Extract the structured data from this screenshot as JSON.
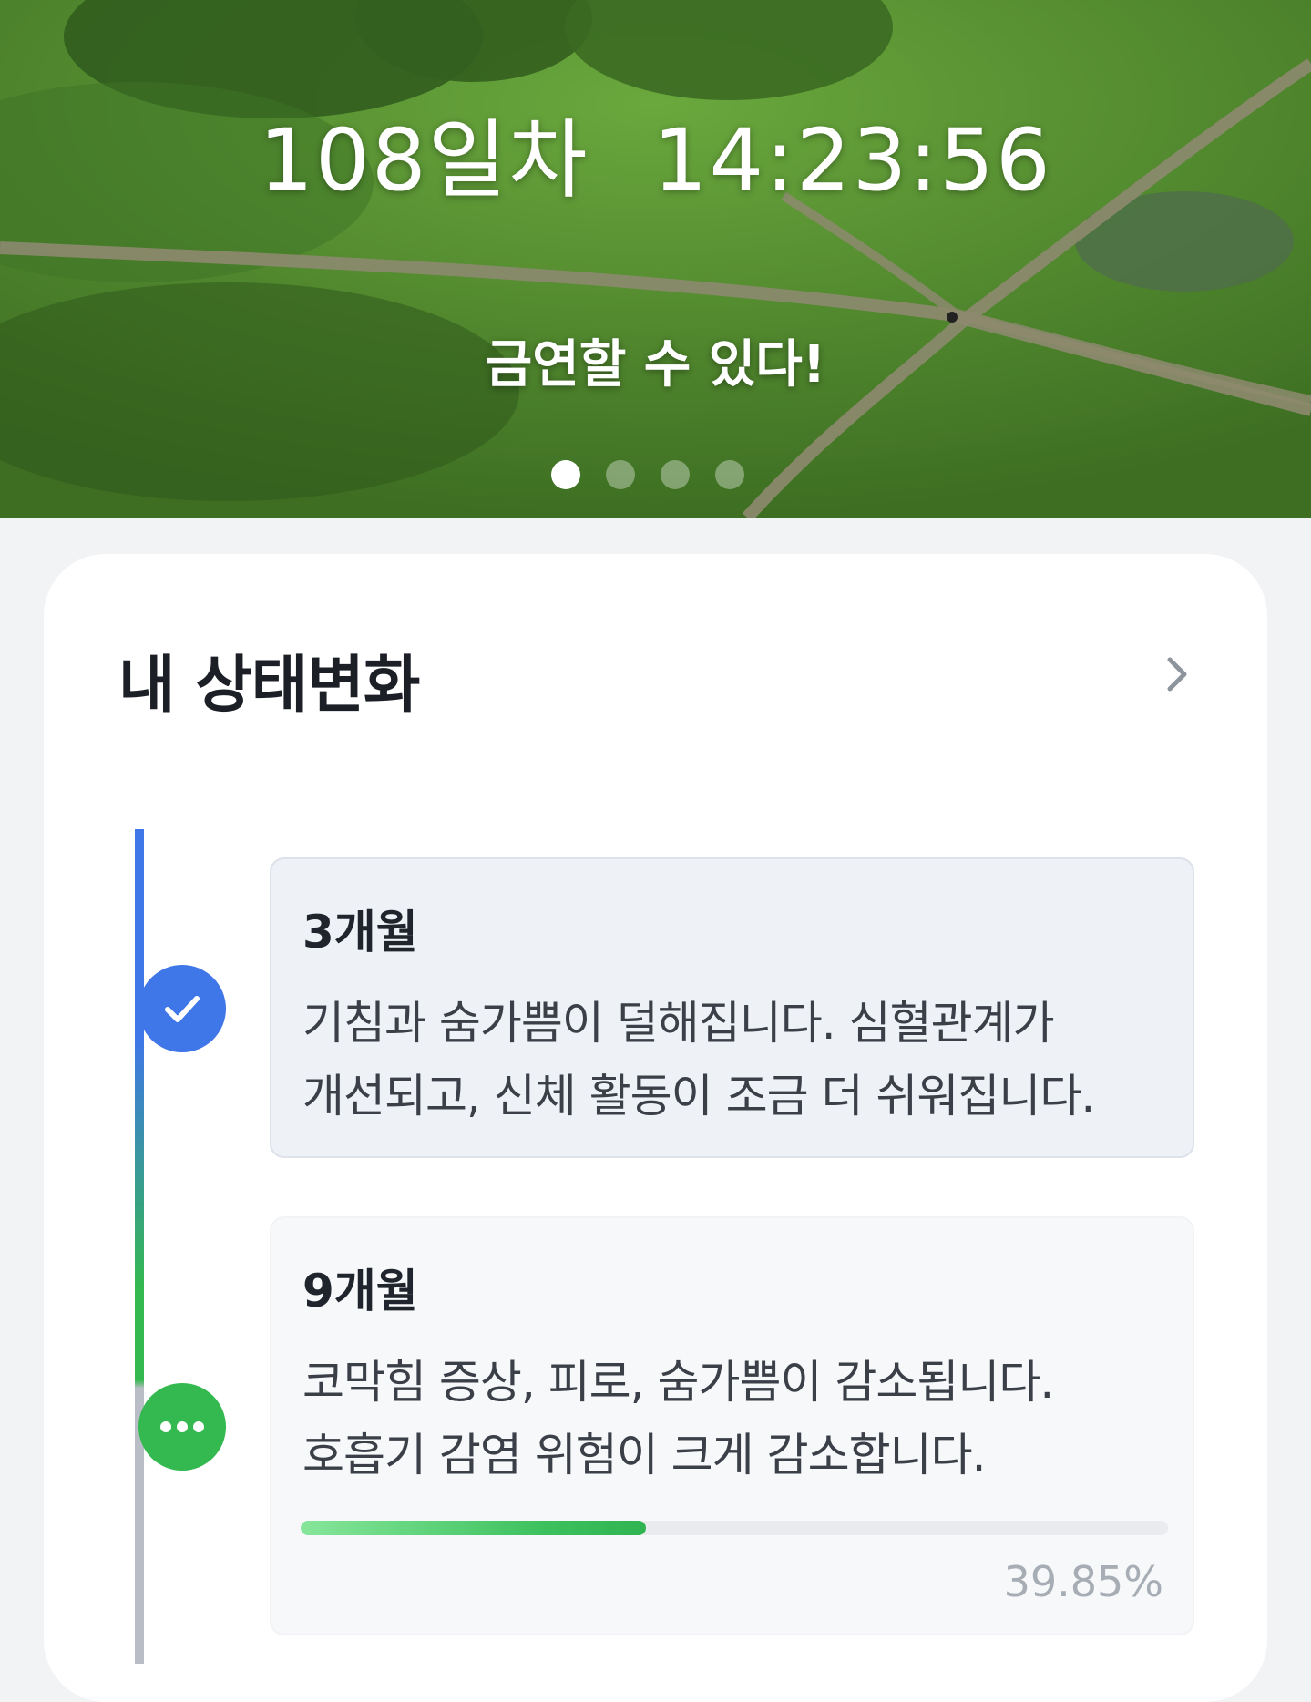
{
  "hero": {
    "days": "108일차",
    "clock": "14:23:56",
    "slogan": "금연할 수 있다!",
    "carousel": {
      "count": 4,
      "active_index": 0
    }
  },
  "status_card": {
    "title": "내 상태변화",
    "more_icon": "chevron-right-icon",
    "milestones": [
      {
        "period": "3개월",
        "description_lines": [
          "기침과 숨가쁨이 덜해집니다. 심혈관계가",
          "개선되고, 신체 활동이 조금 더 쉬워집니다."
        ],
        "state": "completed",
        "icon": "check-icon"
      },
      {
        "period": "9개월",
        "description_lines": [
          "코막힘 증상, 피로, 숨가쁨이 감소됩니다.",
          "호흡기 감염 위험이 크게 감소합니다."
        ],
        "state": "in-progress",
        "icon": "more-dots-icon",
        "progress_percent": 39.85,
        "progress_label": "39.85%"
      }
    ]
  },
  "colors": {
    "completed": "#3f76e8",
    "in_progress": "#33b94f",
    "pending_line": "#b9bec6"
  }
}
